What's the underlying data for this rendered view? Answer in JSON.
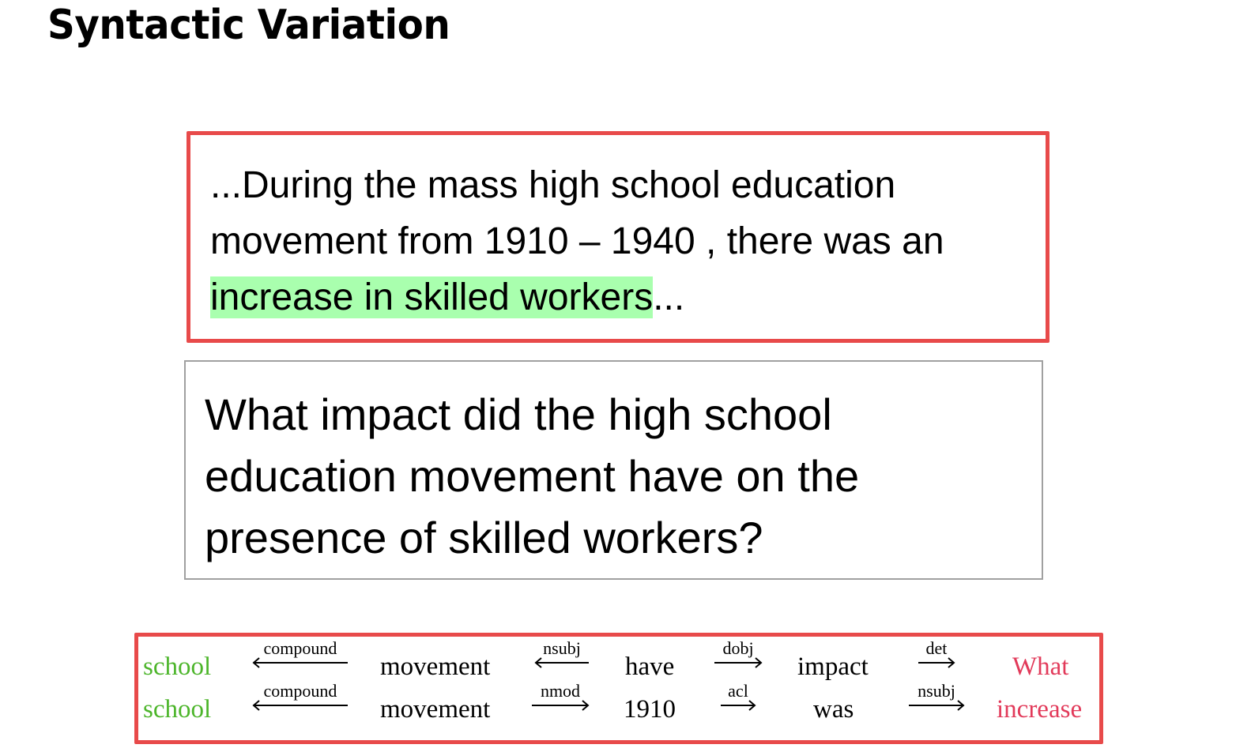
{
  "slide": {
    "title": "Syntactic Variation"
  },
  "passage": {
    "prefix": "...During the mass high school education movement from 1910 – 1940 , there was an ",
    "highlight": "increase in skilled workers",
    "suffix": "...",
    "highlight_color": "#a9ffae",
    "border_color": "#e84a4a"
  },
  "question": {
    "text": "What impact did the high school education movement have on the presence of skilled workers?"
  },
  "dependency_paths": {
    "rows": [
      {
        "tokens": [
          "school",
          "movement",
          "have",
          "impact",
          "What"
        ],
        "relations": [
          {
            "label": "compound",
            "direction": "left"
          },
          {
            "label": "nsubj",
            "direction": "left"
          },
          {
            "label": "dobj",
            "direction": "right"
          },
          {
            "label": "det",
            "direction": "right"
          }
        ]
      },
      {
        "tokens": [
          "school",
          "movement",
          "1910",
          "was",
          "increase"
        ],
        "relations": [
          {
            "label": "compound",
            "direction": "left"
          },
          {
            "label": "nmod",
            "direction": "right"
          },
          {
            "label": "acl",
            "direction": "right"
          },
          {
            "label": "nsubj",
            "direction": "right"
          }
        ]
      }
    ],
    "start_token_color": "#4cb52a",
    "end_token_color": "#e23a5a"
  }
}
